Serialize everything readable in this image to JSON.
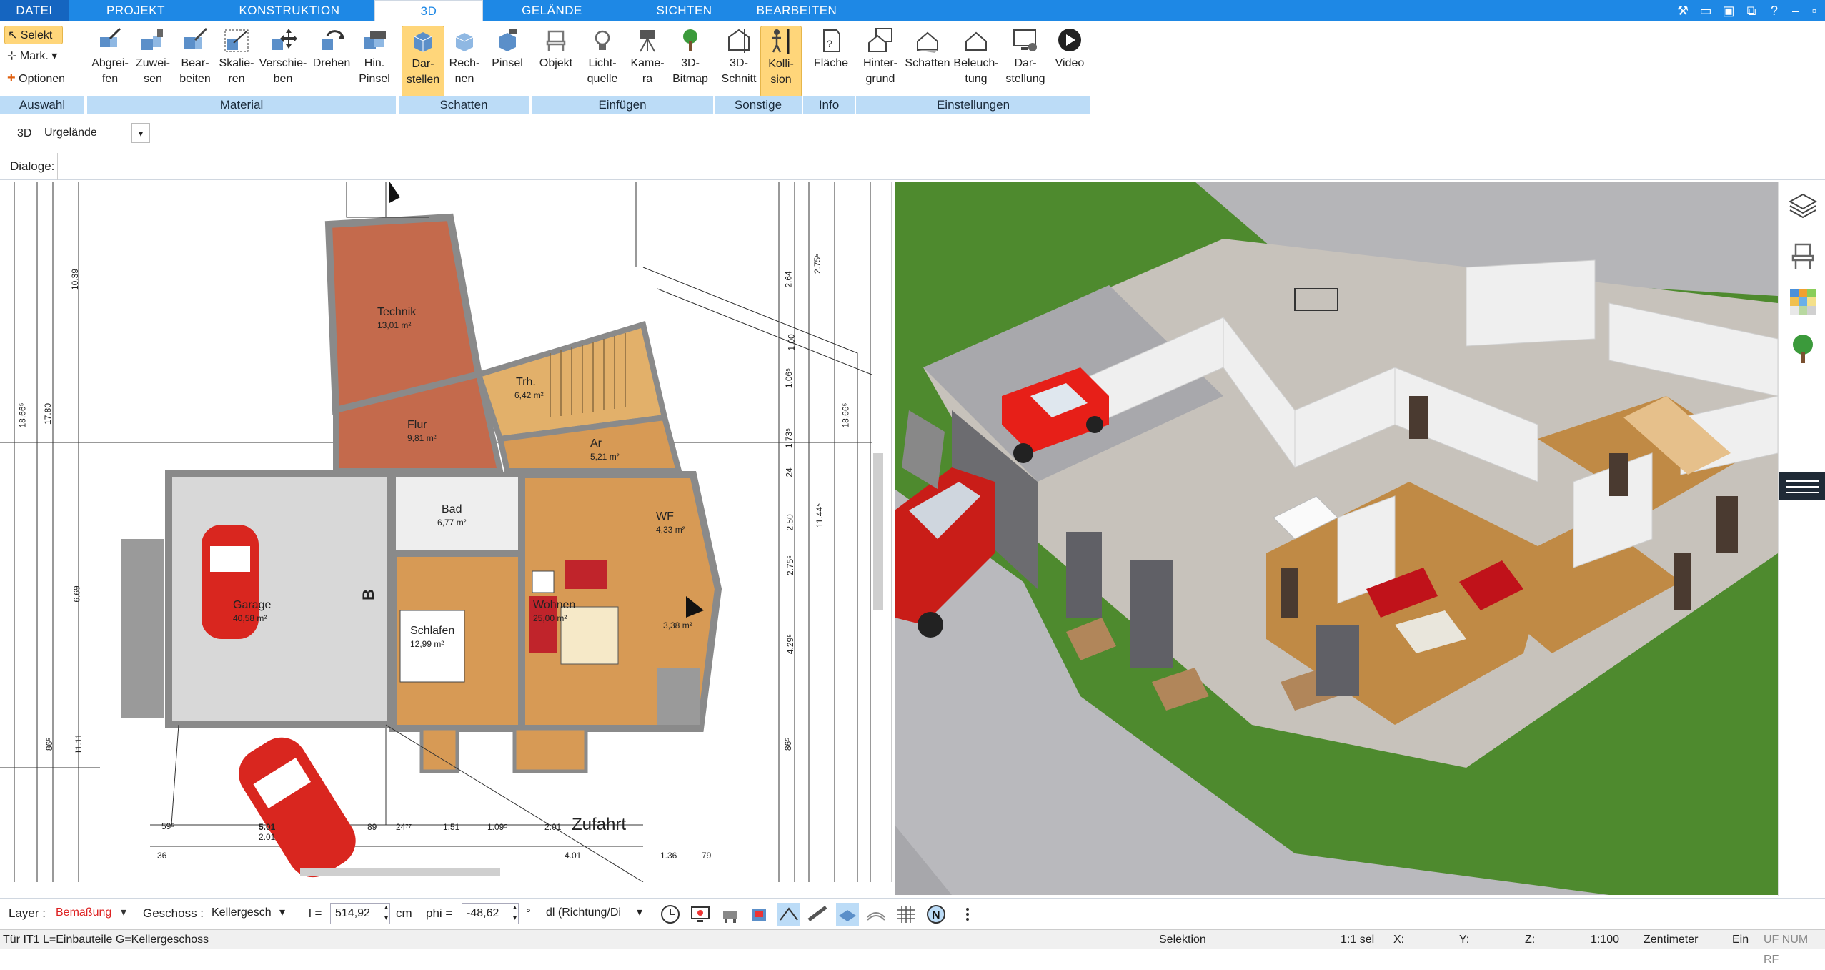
{
  "menu": {
    "tabs": [
      "DATEI",
      "PROJEKT",
      "KONSTRUKTION",
      "3D",
      "GELÄNDE",
      "SICHTEN",
      "BEARBEITEN"
    ],
    "active": "3D"
  },
  "ribbon": {
    "auswahl": {
      "selekt": "Selekt",
      "mark": "Mark.",
      "optionen": "Optionen",
      "group": "Auswahl"
    },
    "material": {
      "abgreifen": "Abgrei-\nfen",
      "zuweisen": "Zuwei-\nsen",
      "bearbeiten": "Bear-\nbeiten",
      "skalieren": "Skalie-\nren",
      "verschieben": "Verschie-\nben",
      "drehen": "Drehen",
      "hinpinsel": "Hin.\nPinsel",
      "group": "Material"
    },
    "schatten": {
      "darstellen": "Dar-\nstellen",
      "rechnen": "Rech-\nnen",
      "pinsel": "Pinsel",
      "group": "Schatten"
    },
    "einfuegen": {
      "objekt": "Objekt",
      "lichtquelle": "Licht-\nquelle",
      "kamera": "Kame-\nra",
      "bitmap": "3D-\nBitmap",
      "group": "Einfügen"
    },
    "sonstige": {
      "schnitt": "3D-\nSchnitt",
      "kollision": "Kolli-\nsion",
      "group": "Sonstige"
    },
    "info": {
      "flaeche": "Fläche",
      "group": "Info"
    },
    "einstellungen": {
      "hintergrund": "Hinter-\ngrund",
      "schatten": "Schatten",
      "beleuchtung": "Beleuch-\ntung",
      "darstellung": "Dar-\nstellung",
      "video": "Video",
      "group": "Einstellungen"
    }
  },
  "toolbar": {
    "mode": "3D",
    "terrain": "Urgelände",
    "dialoge": "Dialoge:"
  },
  "plan": {
    "rooms": [
      {
        "name": "Technik",
        "area": "13,01 m²"
      },
      {
        "name": "Trh.",
        "area": "6,42 m²"
      },
      {
        "name": "Flur",
        "area": "9,81 m²"
      },
      {
        "name": "Ar",
        "area": "5,21 m²"
      },
      {
        "name": "Bad",
        "area": "6,77 m²"
      },
      {
        "name": "WF",
        "area": "4,33 m²"
      },
      {
        "name": "Garage",
        "area": "40,58 m²"
      },
      {
        "name": "Wohnen",
        "area": "25,00 m²"
      },
      {
        "name": "Schlafen",
        "area": "12,99 m²"
      },
      {
        "name": "",
        "area": "3,38 m²"
      }
    ],
    "dims_left": [
      "10.39",
      "17.80",
      "18.66⁵",
      "6.69",
      "11.11",
      "86⁵"
    ],
    "dims_right": [
      "2.64",
      "2.75⁵",
      "1.00",
      "1.06⁵",
      "1.73⁵",
      "24",
      "2.50",
      "2.75⁵",
      "4.29⁵",
      "86⁵",
      "11.44⁵",
      "18.66⁵"
    ],
    "dims_bottom": [
      "59⁵",
      "5.01",
      "2.01",
      "89",
      "24⁷⁷",
      "1.51",
      "1.09⁵",
      "2.01",
      "36",
      "4.01",
      "1.36",
      "79"
    ],
    "street": "Zufahrt",
    "section_mark": "B"
  },
  "statusbar": {
    "layer_label": "Layer :",
    "layer_value": "Bemaßung",
    "geschoss_label": "Geschoss :",
    "geschoss_value": "Kellergesch",
    "l_label": "l =",
    "l_value": "514,92",
    "l_unit": "cm",
    "phi_label": "phi =",
    "phi_value": "-48,62",
    "phi_unit": "°",
    "dl_value": "dl (Richtung/Di"
  },
  "status2": {
    "hint": "Tür IT1 L=Einbauteile G=Kellergeschoss",
    "mode": "Selektion",
    "sel": "1:1 sel",
    "x": "X:",
    "y": "Y:",
    "z": "Z:",
    "scale": "1:100",
    "unit": "Zentimeter",
    "ein": "Ein",
    "flags": "UF NUM RF"
  },
  "colors": {
    "accent": "#1e88e5",
    "ribbon_group": "#bcdcf7",
    "wood": "#d79a55",
    "tile": "#c05a44",
    "grass": "#4e8a2e"
  }
}
